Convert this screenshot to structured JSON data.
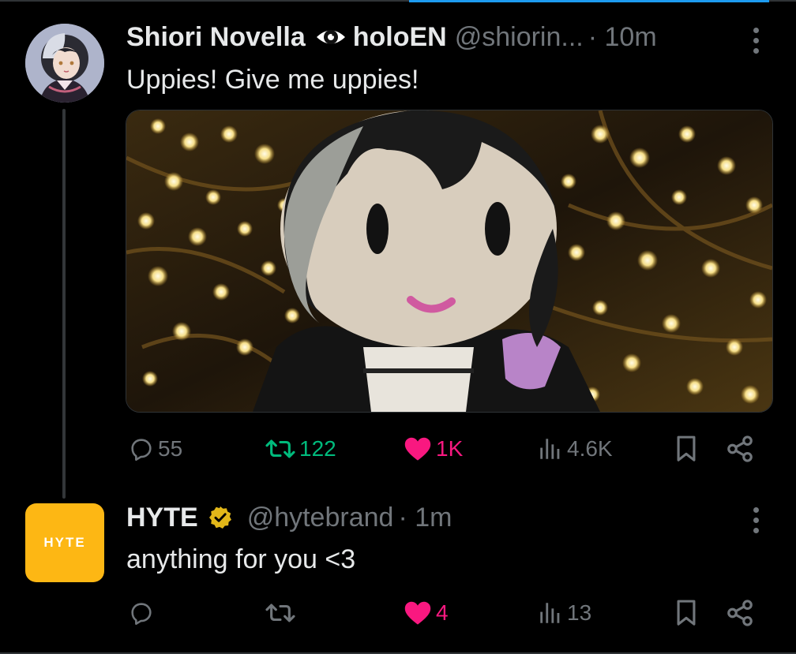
{
  "colors": {
    "background": "#000000",
    "text": "#e7e9ea",
    "muted": "#71767b",
    "repost_active": "#00ba7c",
    "like_active": "#f91880",
    "affiliate_badge": "#e2b719",
    "hyte_brand": "#fdb714",
    "accent": "#1d9bf0"
  },
  "tweet1": {
    "display_name": "Shiori Novella",
    "affiliate_icon": "holoen-eye-icon",
    "affiliate_name": "holoEN",
    "handle": "@shiorin...",
    "time": "· 10m",
    "text": "Uppies! Give me uppies!",
    "media_icon": "photo-crochet-doll",
    "actions": {
      "replies": "55",
      "reposts": "122",
      "likes": "1K",
      "views": "4.6K"
    }
  },
  "tweet2": {
    "display_name": "HYTE",
    "verified_icon": "gold-verified-badge-icon",
    "handle": "@hytebrand",
    "time": "· 1m",
    "avatar_text": "HYTE",
    "text": "anything for you <3",
    "actions": {
      "replies": "",
      "reposts": "",
      "likes": "4",
      "views": "13"
    }
  }
}
